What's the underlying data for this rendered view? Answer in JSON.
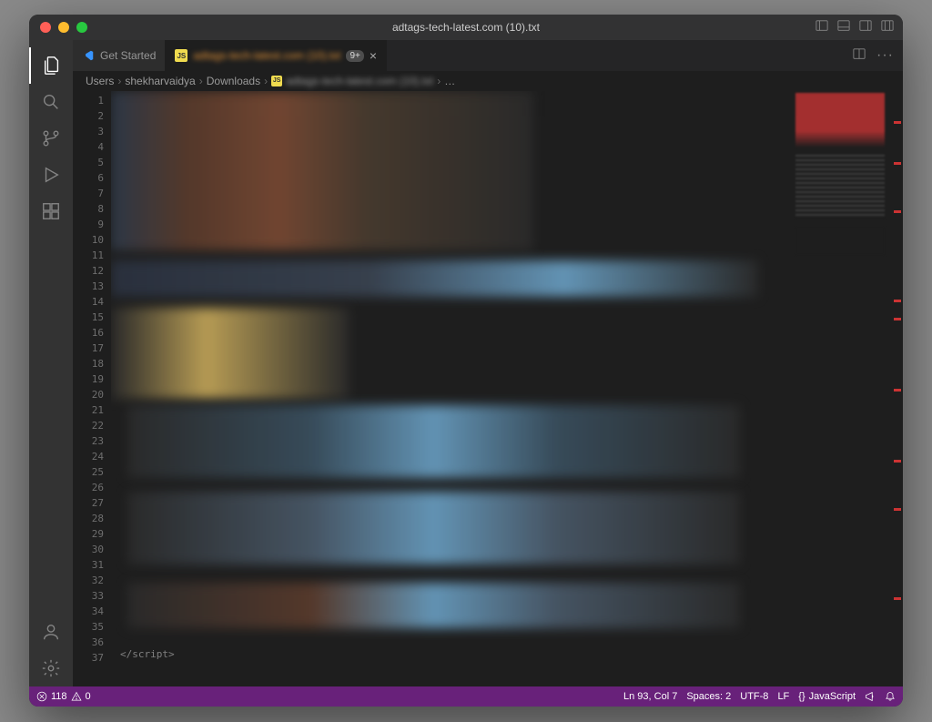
{
  "window": {
    "title": "adtags-tech-latest.com (10).txt"
  },
  "tabs": [
    {
      "icon": "vscode",
      "label": "Get Started",
      "active": false
    },
    {
      "icon": "js",
      "label": "adtags-tech-latest.com (10).txt",
      "badge": "9+",
      "active": true
    }
  ],
  "breadcrumb": {
    "parts": [
      "Users",
      "shekharvaidya",
      "Downloads"
    ],
    "file_icon": "js",
    "file": "adtags-tech-latest.com (10).txt",
    "tail": "…"
  },
  "gutter": {
    "start": 1,
    "end": 37
  },
  "code": {
    "visible_snippet": "</script>"
  },
  "statusbar": {
    "errors": "118",
    "warnings": "0",
    "cursor": "Ln 93, Col 7",
    "indent": "Spaces: 2",
    "encoding": "UTF-8",
    "eol": "LF",
    "lang_icon": "{}",
    "lang": "JavaScript"
  }
}
